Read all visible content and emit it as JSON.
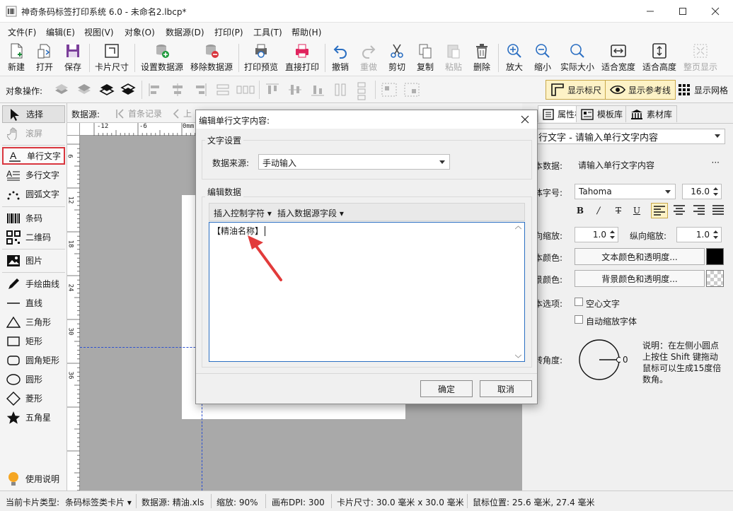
{
  "window": {
    "title": "神奇条码标签打印系统 6.0 - 未命名2.lbcp*"
  },
  "menu": [
    "文件(F)",
    "编辑(E)",
    "视图(V)",
    "对象(O)",
    "数据源(D)",
    "打印(P)",
    "工具(T)",
    "帮助(H)"
  ],
  "toolbar": {
    "new": "新建",
    "open": "打开",
    "save": "保存",
    "card_size": "卡片尺寸",
    "set_datasource": "设置数据源",
    "remove_datasource": "移除数据源",
    "print_preview": "打印预览",
    "direct_print": "直接打印",
    "undo": "撤销",
    "redo": "重做",
    "cut": "剪切",
    "copy": "复制",
    "paste": "粘贴",
    "delete": "删除",
    "zoom_in": "放大",
    "zoom_out": "缩小",
    "actual_size": "实际大小",
    "fit_width": "适合宽度",
    "fit_height": "适合高度",
    "fit_page": "整页显示"
  },
  "objbar": {
    "label": "对象操作:",
    "show_ruler": "显示标尺",
    "show_guides": "显示参考线",
    "show_grid": "显示网格"
  },
  "tools": {
    "select": "选择",
    "scroll": "滚屏",
    "single_text": "单行文字",
    "multi_text": "多行文字",
    "arc_text": "圆弧文字",
    "barcode": "条码",
    "qrcode": "二维码",
    "image": "图片",
    "freehand": "手绘曲线",
    "line": "直线",
    "triangle": "三角形",
    "rect": "矩形",
    "round_rect": "圆角矩形",
    "ellipse": "圆形",
    "diamond": "菱形",
    "star": "五角星",
    "help": "使用说明"
  },
  "navbar": {
    "label": "数据源:",
    "first": "首条记录",
    "prev": "上"
  },
  "ruler_h": [
    "-12",
    "-6",
    "0mm"
  ],
  "ruler_v": [
    "6",
    "12",
    "18",
    "24",
    "30",
    "36"
  ],
  "right": {
    "tabs": [
      "属性栏",
      "模板库",
      "素材库"
    ],
    "object_selector": "行文字 - 请输入单行文字内容",
    "data_label": "本数据:",
    "data_value": "请输入单行文字内容",
    "font_label": "体字号:",
    "font_name": "Tahoma",
    "font_size": "16.0",
    "hscale_label": "向缩放:",
    "hscale_value": "1.0",
    "vscale_label": "纵向缩放:",
    "vscale_value": "1.0",
    "text_color_label": "本颜色:",
    "text_color_btn": "文本颜色和透明度...",
    "bg_color_label": "景颜色:",
    "bg_color_btn": "背景颜色和透明度...",
    "options_label": "本选项:",
    "hollow": "空心文字",
    "autoshrink": "自动缩放字体",
    "rotate_label": "转角度:",
    "rotate_value": "0",
    "rotate_note": "说明：在左侧小圆点上按住 Shift 键拖动鼠标可以生成15度倍数角。",
    "colors": {
      "text": "#000000"
    }
  },
  "status": {
    "card_type_label": "当前卡片类型:",
    "card_type": "条码标签类卡片",
    "datasource": "数据源: 精油.xls",
    "zoom": "缩放: 90%",
    "dpi": "画布DPI: 300",
    "card_size": "卡片尺寸: 30.0 毫米 x 30.0 毫米",
    "mouse_pos": "鼠标位置: 25.6 毫米, 27.4 毫米"
  },
  "dialog": {
    "title": "编辑单行文字内容:",
    "group_text": "文字设置",
    "source_label": "数据来源:",
    "source_value": "手动输入",
    "group_edit": "编辑数据",
    "insert_ctrl": "插入控制字符",
    "insert_field": "插入数据源字段",
    "content": "【精油名称】",
    "ok": "确定",
    "cancel": "取消"
  },
  "accent_color": "#d9363e"
}
